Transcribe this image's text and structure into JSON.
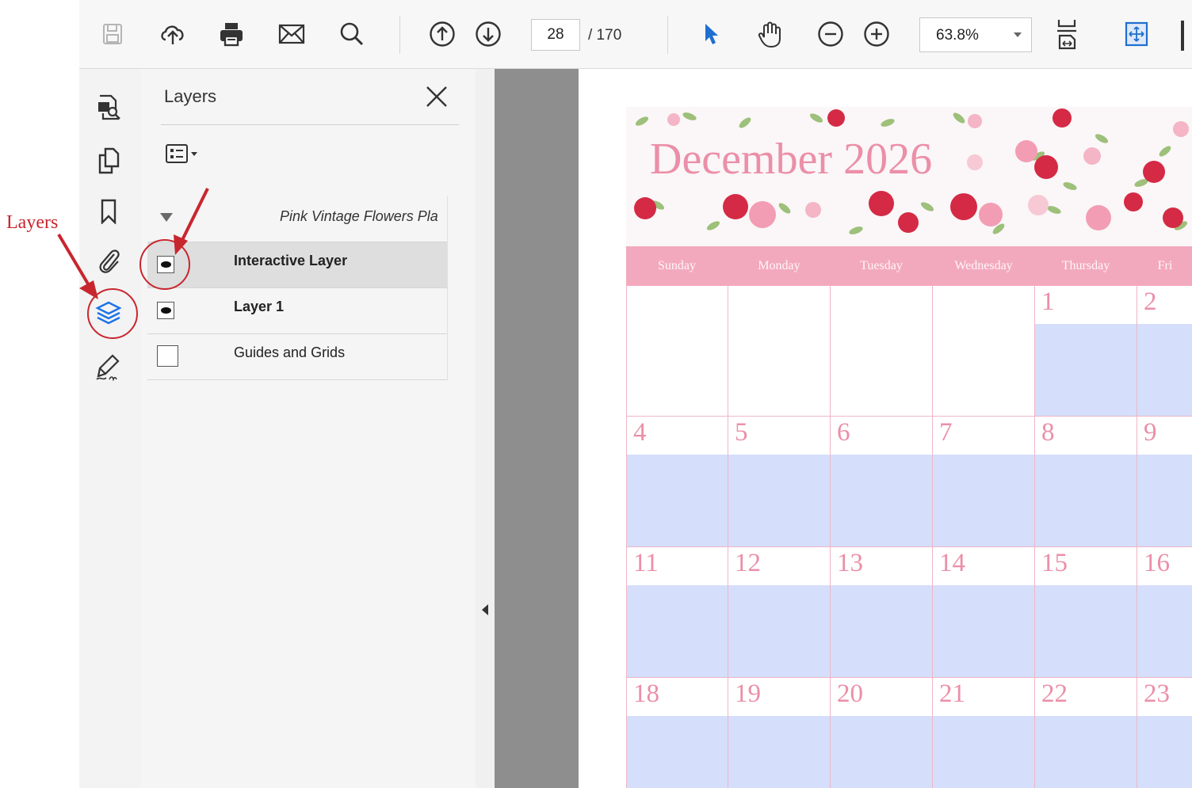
{
  "toolbar": {
    "icons": [
      "save-icon",
      "upload-icon",
      "print-icon",
      "email-icon",
      "search-icon",
      "prev-page-icon",
      "next-page-icon",
      "select-tool-icon",
      "hand-tool-icon",
      "zoom-out-icon",
      "zoom-in-icon",
      "page-fit-icon",
      "scroll-mode-icon"
    ],
    "page_number": "28",
    "page_total": "/ 170",
    "zoom": "63.8%"
  },
  "sidebar": {
    "icons": [
      "page-thumbnails-icon",
      "copy-pages-icon",
      "bookmark-icon",
      "attachment-icon",
      "layers-icon",
      "signature-icon"
    ],
    "active": "layers-icon"
  },
  "layers_panel": {
    "title": "Layers",
    "root": "Pink Vintage Flowers Pla",
    "layers": [
      {
        "name": "Interactive Layer",
        "visible": true,
        "selected": true,
        "bold": true
      },
      {
        "name": "Layer 1",
        "visible": true,
        "selected": false,
        "bold": true
      },
      {
        "name": "Guides and Grids",
        "visible": false,
        "selected": false,
        "bold": false
      }
    ]
  },
  "document": {
    "title": "December 2026",
    "days": [
      "Sunday",
      "Monday",
      "Tuesday",
      "Wednesday",
      "Thursday",
      "Fri"
    ],
    "weeks": [
      [
        "",
        "",
        "",
        "",
        "1",
        "2"
      ],
      [
        "4",
        "5",
        "6",
        "7",
        "8",
        "9"
      ],
      [
        "11",
        "12",
        "13",
        "14",
        "15",
        "16"
      ],
      [
        "18",
        "19",
        "20",
        "21",
        "22",
        "23"
      ]
    ]
  },
  "annotation": {
    "label": "Layers",
    "color": "#c8262e"
  },
  "colors": {
    "accent_blue": "#1a73e8",
    "calendar_pink": "#f3a9bd",
    "calendar_blue": "#d5defa"
  }
}
